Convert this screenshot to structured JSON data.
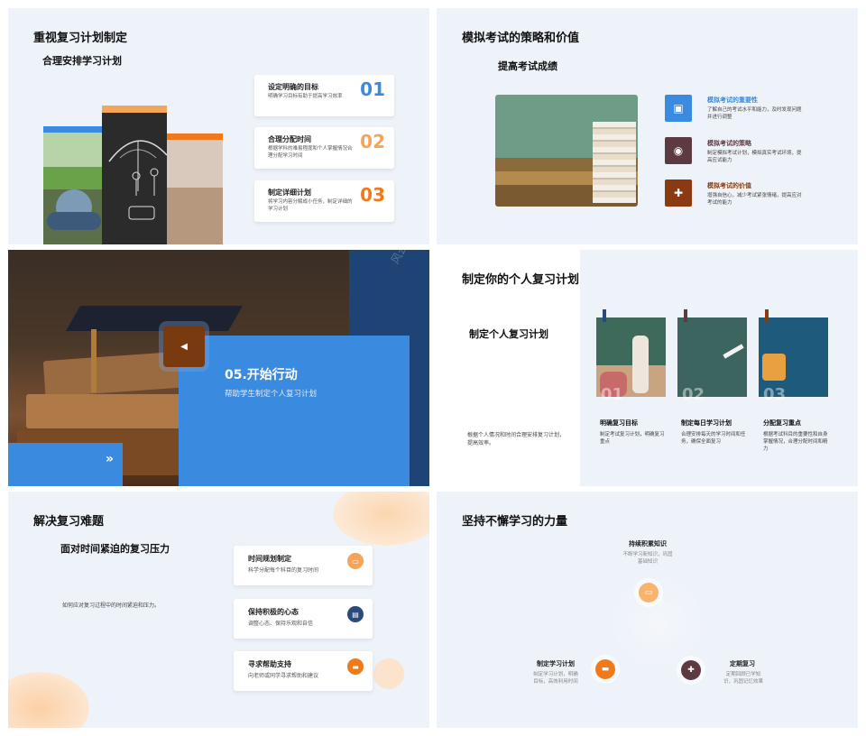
{
  "slide1": {
    "title": "重视复习计划制定",
    "subtitle": "合理安排学习计划",
    "cards": [
      {
        "title": "设定明确的目标",
        "desc": "明确学习目标有助于提高学习效率",
        "num": "01",
        "color": "#3a8be0"
      },
      {
        "title": "合理分配时间",
        "desc": "根据学科的难易程度和个人掌握情况合理分配学习时间",
        "num": "02",
        "color": "#f5a55a"
      },
      {
        "title": "制定详细计划",
        "desc": "将学习内容分解成小任务，制定详细的学习计划",
        "num": "03",
        "color": "#f07a1a"
      }
    ]
  },
  "slide2": {
    "title": "模拟考试的策略和价值",
    "subtitle": "提高考试成绩",
    "items": [
      {
        "title": "模拟考试的重要性",
        "desc": "了解自己的考试水平和能力，及时发现问题并进行调整",
        "color": "#3a8be0",
        "icon": "image-icon"
      },
      {
        "title": "模拟考试的策略",
        "desc": "制定模拟考试计划，模拟真实考试环境，提高应试能力",
        "color": "#5b3a42",
        "icon": "target-icon"
      },
      {
        "title": "模拟考试的价值",
        "desc": "增强自信心，减少考试紧张情绪，提高应对考试的能力",
        "color": "#8a3a10",
        "icon": "puzzle-icon"
      }
    ]
  },
  "slide3": {
    "watermark": "风云办公",
    "title": "05.开始行动",
    "subtitle": "帮助学生制定个人复习计划"
  },
  "slide4": {
    "title": "制定你的个人复习计划",
    "subtitle": "制定个人复习计划",
    "desc": "根据个人情况和时间合理安排复习计划，提高效率。",
    "columns": [
      {
        "num": "01",
        "title": "明确复习目标",
        "desc": "制定考试复习计划，明确复习重点"
      },
      {
        "num": "02",
        "title": "制定每日学习计划",
        "desc": "合理安排每天的学习时间和任务，确保全面复习"
      },
      {
        "num": "03",
        "title": "分配复习重点",
        "desc": "根据考试科目的重要性和自身掌握情况，合理分配时间和精力"
      }
    ]
  },
  "slide5": {
    "title": "解决复习难题",
    "subtitle": "面对时间紧迫的复习压力",
    "desc": "如何应对复习过程中的时间紧迫和压力。",
    "cards": [
      {
        "title": "时间规划制定",
        "desc": "科学分配每个科目的复习时间",
        "color": "#f5a55a"
      },
      {
        "title": "保持积极的心态",
        "desc": "调整心态、保持乐观和自信",
        "color": "#2a4a7a"
      },
      {
        "title": "寻求帮助支持",
        "desc": "向老师或同学寻求帮助和建议",
        "color": "#f07a1a"
      }
    ]
  },
  "slide6": {
    "title": "坚持不懈学习的力量",
    "nodes": [
      {
        "title": "持续积累知识",
        "desc": "不断学习新知识，巩固基础知识"
      },
      {
        "title": "制定学习计划",
        "desc": "制定学习计划，明确目标，高效利用时间"
      },
      {
        "title": "定期复习",
        "desc": "定期回顾已学知识，巩固记忆效果"
      }
    ]
  }
}
